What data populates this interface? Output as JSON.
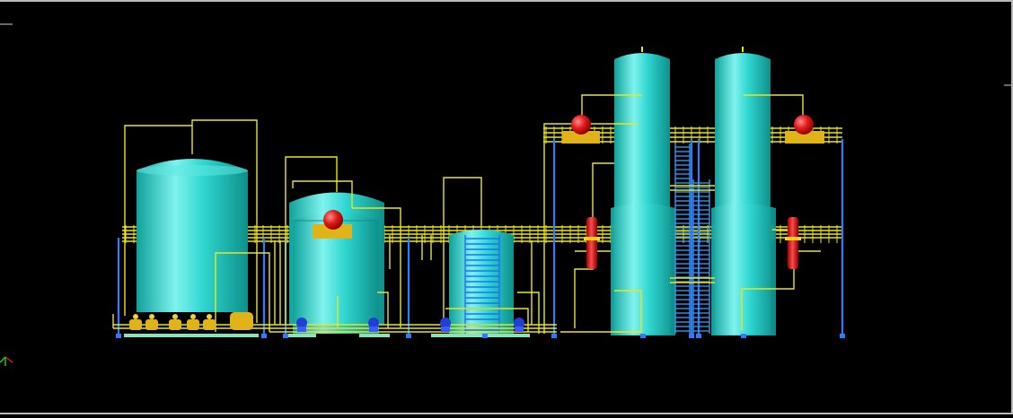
{
  "colors": {
    "background": "#000000",
    "frame": "#b8b8b8",
    "vessel": "#2fd6d0",
    "vessel_light": "#8ff5f0",
    "vessel_dark": "#15a9a4",
    "pipe": "#e9e61d",
    "pipe_dark": "#b8b600",
    "support": "#2d7bff",
    "pump": "#1f3fd6",
    "valve_red": "#e01a1a",
    "skid": "#e0b418",
    "base": "#8fe0b8",
    "ucs_x": "#e01a1a",
    "ucs_y": "#18d818"
  },
  "icons": {
    "ucs": "ucs-axes-icon",
    "pump": "pump-icon",
    "valve": "valve-icon",
    "filter": "cartridge-filter-icon"
  }
}
